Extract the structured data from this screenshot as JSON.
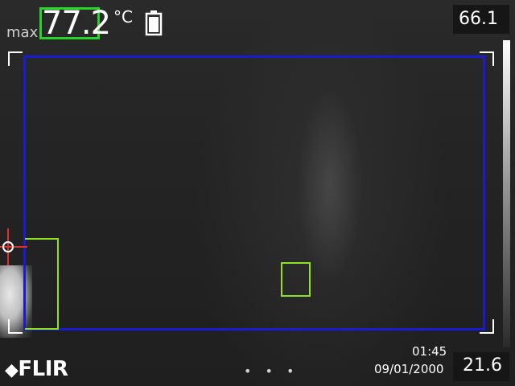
{
  "overlay": {
    "max_label": "max",
    "max_value": "77.2",
    "unit": "°C",
    "battery_icon": "battery-icon"
  },
  "scale": {
    "top": "66.1",
    "bottom": "21.6"
  },
  "status": {
    "time": "01:45",
    "date": "09/01/2000",
    "pager": "• • •",
    "logo": "FLIR"
  },
  "colors": {
    "max_box": "#27d427",
    "measure_area": "#1a1ad2",
    "spot_box": "#8fe21e",
    "crosshair": "#e03030"
  }
}
